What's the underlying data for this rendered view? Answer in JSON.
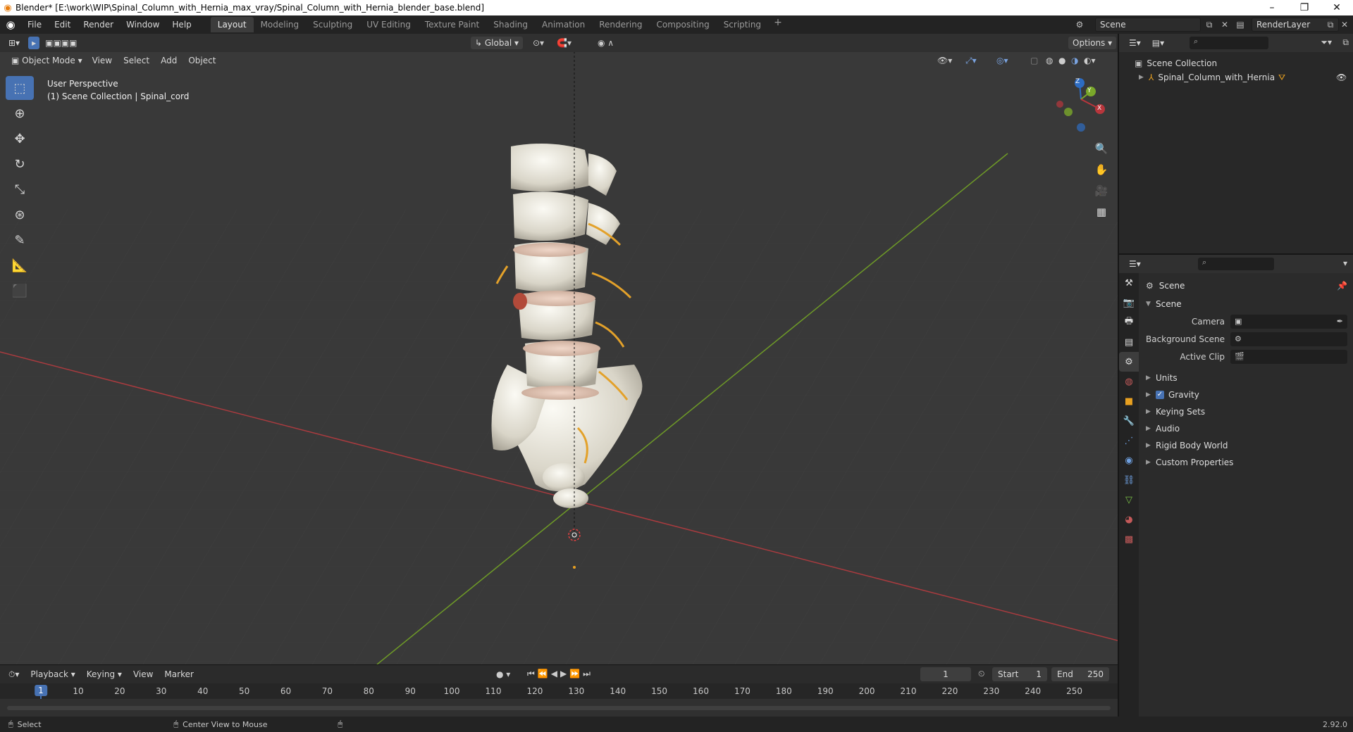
{
  "window": {
    "title": "Blender* [E:\\work\\WIP\\Spinal_Column_with_Hernia_max_vray/Spinal_Column_with_Hernia_blender_base.blend]",
    "controls": [
      "–",
      "❐",
      "✕"
    ]
  },
  "menubar": {
    "menus": [
      "File",
      "Edit",
      "Render",
      "Window",
      "Help"
    ],
    "workspaces": [
      "Layout",
      "Modeling",
      "Sculpting",
      "UV Editing",
      "Texture Paint",
      "Shading",
      "Animation",
      "Rendering",
      "Compositing",
      "Scripting"
    ],
    "active_workspace": "Layout",
    "scene": "Scene",
    "view_layer": "RenderLayer"
  },
  "viewport": {
    "mode": "Object Mode",
    "menus": [
      "View",
      "Select",
      "Add",
      "Object"
    ],
    "transform_orientation": "Global",
    "options_label": "Options",
    "info_line1": "User Perspective",
    "info_line2": "(1) Scene Collection | Spinal_cord",
    "gizmo_axes": [
      "Z",
      "Y",
      "X"
    ],
    "tools": [
      "select-box",
      "cursor",
      "move",
      "rotate",
      "scale",
      "transform",
      "annotate",
      "measure",
      "add-cube"
    ]
  },
  "timeline": {
    "menus": [
      "Playback",
      "Keying",
      "View",
      "Marker"
    ],
    "current_frame": "1",
    "start_label": "Start",
    "start": "1",
    "end_label": "End",
    "end": "250",
    "ruler": [
      "1",
      "10",
      "20",
      "30",
      "40",
      "50",
      "60",
      "70",
      "80",
      "90",
      "100",
      "110",
      "120",
      "130",
      "140",
      "150",
      "160",
      "170",
      "180",
      "190",
      "200",
      "210",
      "220",
      "230",
      "240",
      "250"
    ]
  },
  "outliner": {
    "root": "Scene Collection",
    "items": [
      "Spinal_Column_with_Hernia"
    ]
  },
  "properties": {
    "context": "Scene",
    "panel": "Scene",
    "fields": [
      {
        "label": "Camera",
        "value": ""
      },
      {
        "label": "Background Scene",
        "value": ""
      },
      {
        "label": "Active Clip",
        "value": ""
      }
    ],
    "subpanels": [
      "Units",
      "Gravity",
      "Keying Sets",
      "Audio",
      "Rigid Body World",
      "Custom Properties"
    ]
  },
  "statusbar": {
    "left": "Select",
    "middle": "Center View to Mouse",
    "version": "2.92.0"
  },
  "colors": {
    "accent": "#4772b3",
    "x_axis": "#b8363c",
    "y_axis": "#7aa82a",
    "z_axis": "#2d6cc2"
  }
}
